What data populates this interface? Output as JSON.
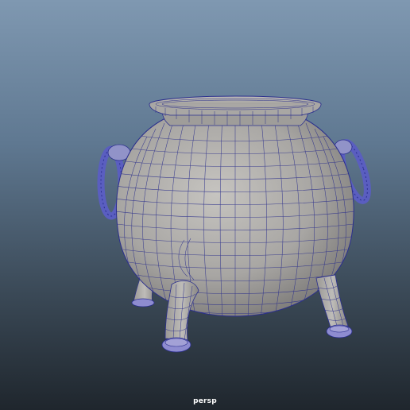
{
  "viewport": {
    "camera_label": "persp",
    "object": "cauldron-mesh",
    "display_mode": "wireframe-on-shaded"
  },
  "colors": {
    "background_top": "#7f98b1",
    "background_bottom": "#1f262d",
    "mesh_fill": "#a7a5a2",
    "wire": "#2b2f8e",
    "selected_highlight": "#4b4fd0"
  }
}
